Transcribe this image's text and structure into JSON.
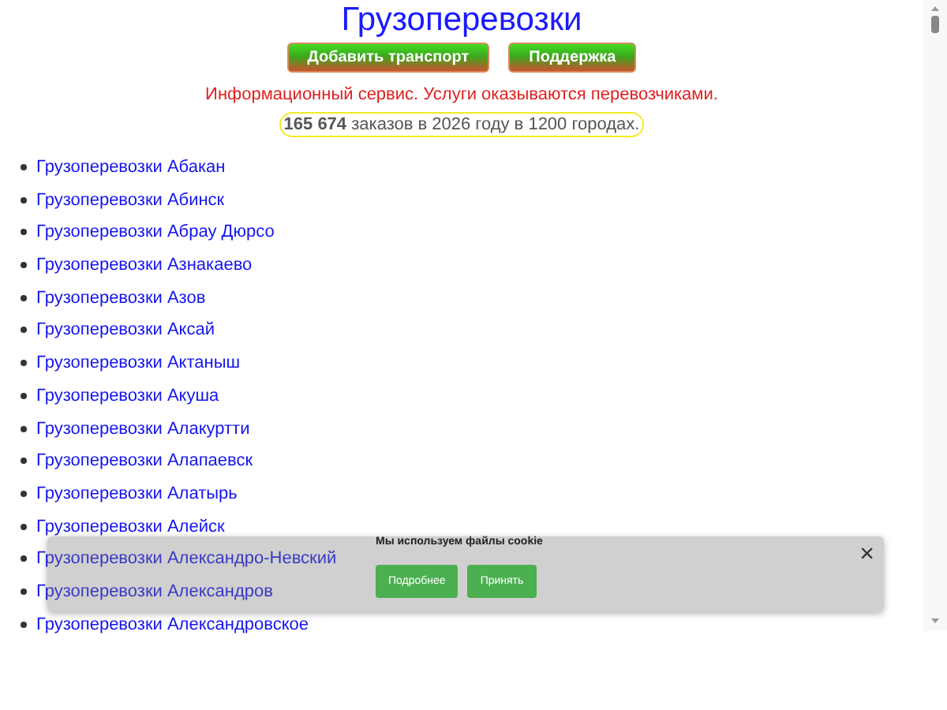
{
  "header": {
    "title": "Грузоперевозки",
    "buttons": [
      "Добавить транспорт",
      "Поддержка"
    ],
    "notice": "Информационный сервис. Услуги оказываются перевозчиками.",
    "stats": "**165 674** заказов в 2026 году в 1200 городах."
  },
  "cities": [
    "Грузоперевозки Абакан",
    "Грузоперевозки Абинск",
    "Грузоперевозки Абрау Дюрсо",
    "Грузоперевозки Азнакаево",
    "Грузоперевозки Азов",
    "Грузоперевозки Аксай",
    "Грузоперевозки Актаныш",
    "Грузоперевозки Акуша",
    "Грузоперевозки Алакуртти",
    "Грузоперевозки Алапаевск",
    "Грузоперевозки Алатырь",
    "Грузоперевозки Алейск",
    "Грузоперевозки Александро-Невский",
    "Грузоперевозки Александров",
    "Грузоперевозки Александровское"
  ],
  "cookie_banner": {
    "message": "Мы используем файлы cookie",
    "close": "×",
    "buttons": [
      "Подробнее",
      "Принять"
    ]
  }
}
